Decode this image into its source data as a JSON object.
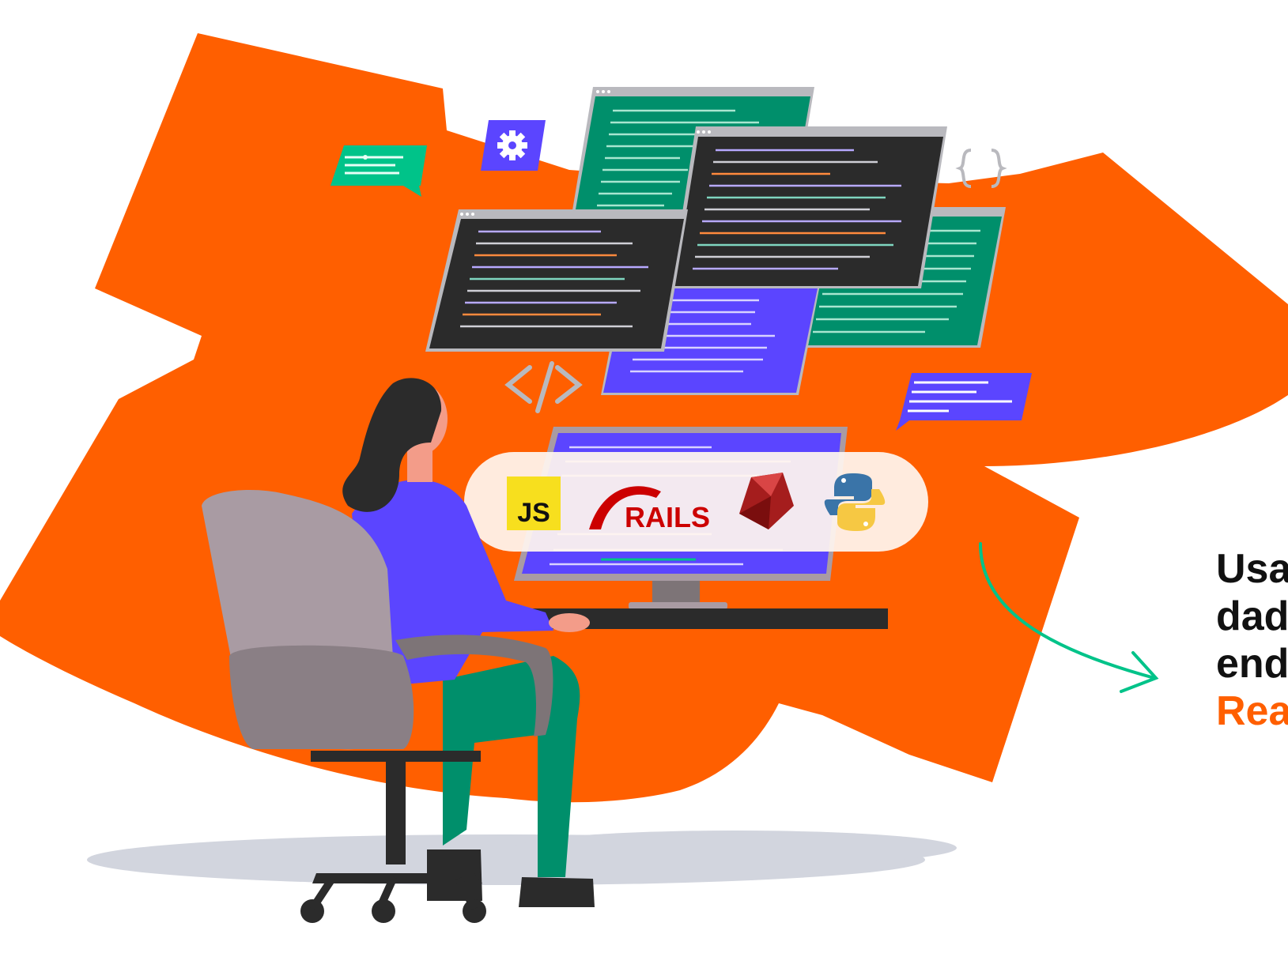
{
  "colors": {
    "background": "#ffffff",
    "blob": "#ff5f00",
    "accent_green": "#00c389",
    "accent_purple": "#5b45ff",
    "code_green": "#008f6b",
    "editor_dark": "#2b2b2b",
    "chair": "#a99ba3",
    "text": "#111111",
    "accent_text": "#ff5f00"
  },
  "logos": {
    "js": "JS",
    "rails": "RAILS"
  },
  "icons": [
    "gear-icon",
    "curly-braces-icon",
    "code-tag-icon",
    "chat-bubble-icon",
    "arrow-icon",
    "ruby-icon",
    "python-icon"
  ],
  "headline": {
    "line1": "Usa",
    "line2": "dad",
    "line3": "end",
    "line4": "Rea"
  }
}
